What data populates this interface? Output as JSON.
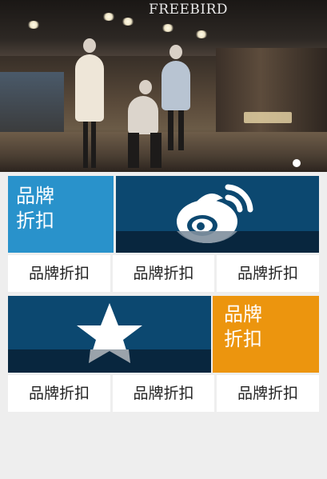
{
  "banner": {
    "store_sign": "FREEBIRD",
    "slide_count": 1,
    "active_slide": 1
  },
  "colors": {
    "blue_light": "#2992cb",
    "navy": "#0c4870",
    "navy_dark": "#08263e",
    "orange": "#ec950e",
    "cell_bg": "#ffffff",
    "page_bg": "#eeeeee"
  },
  "section_1": {
    "feature_tile_label_line1": "品牌",
    "feature_tile_label_line2": "折扣",
    "icon_tile_icon": "weibo-icon",
    "cells": [
      "品牌折扣",
      "品牌折扣",
      "品牌折扣"
    ]
  },
  "section_2": {
    "icon_tile_icon": "star-icon",
    "feature_tile_label_line1": "品牌",
    "feature_tile_label_line2": "折扣",
    "cells": [
      "品牌折扣",
      "品牌折扣",
      "品牌折扣"
    ]
  }
}
